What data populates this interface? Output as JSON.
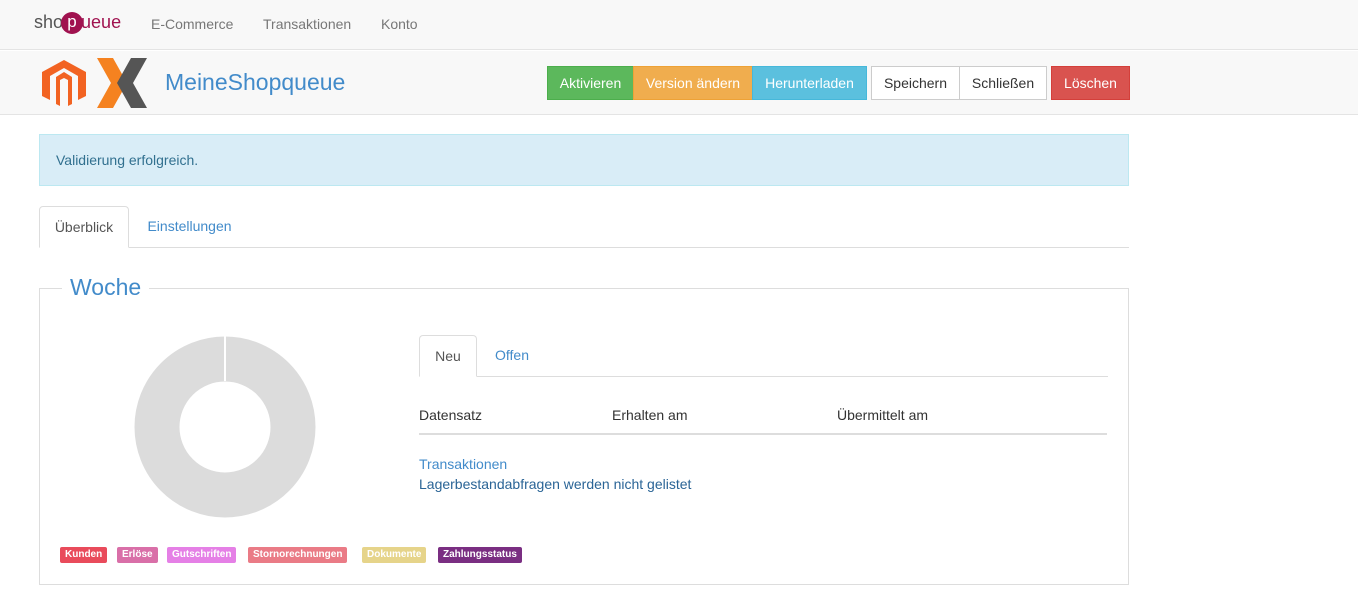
{
  "nav": {
    "brand": {
      "prefix": "sho",
      "circle": "p",
      "suffix": "ueue"
    },
    "links": [
      "E-Commerce",
      "Transaktionen",
      "Konto"
    ]
  },
  "header": {
    "title": "MeineShopqueue",
    "logos": [
      "magento-icon",
      "x-logo-icon"
    ],
    "buttons": {
      "activate": "Aktivieren",
      "change_version": "Version ändern",
      "download": "Herunterladen",
      "save": "Speichern",
      "close": "Schließen",
      "delete": "Löschen"
    },
    "colors": {
      "success": "#5cb85c",
      "warning": "#f0ad4e",
      "info": "#5bc0de",
      "danger": "#d9534f"
    }
  },
  "alert": {
    "message": "Validierung erfolgreich."
  },
  "tabs": {
    "overview": "Überblick",
    "settings": "Einstellungen",
    "active": "overview"
  },
  "week": {
    "title": "Woche",
    "subtabs": {
      "new": "Neu",
      "open": "Offen",
      "active": "new"
    },
    "table": {
      "columns": [
        "Datensatz",
        "Erhalten am",
        "Übermittelt am"
      ]
    },
    "transactions_link": "Transaktionen",
    "inventory_note": "Lagerbestandabfragen werden nicht gelistet",
    "legend": [
      {
        "label": "Kunden",
        "color": "#e94b5b"
      },
      {
        "label": "Erlöse",
        "color": "#d96fa8"
      },
      {
        "label": "Gutschriften",
        "color": "#e580e6"
      },
      {
        "label": "Stornorechnungen",
        "color": "#ea7b86"
      },
      {
        "label": "Dokumente",
        "color": "#e6d48a"
      },
      {
        "label": "Zahlungsstatus",
        "color": "#7a2e82"
      }
    ]
  }
}
